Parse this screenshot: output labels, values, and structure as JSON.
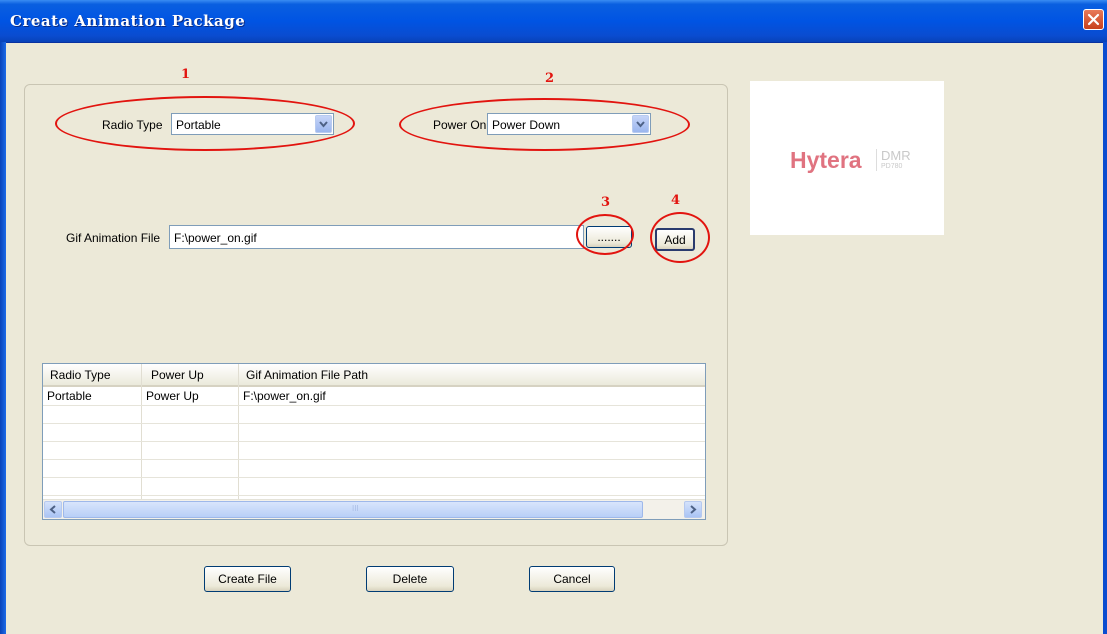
{
  "window": {
    "title": "Create Animation Package",
    "close_icon": "close-icon"
  },
  "form": {
    "radio_type_label": "Radio Type",
    "radio_type_value": "Portable",
    "power_on_label": "Power On",
    "power_on_value": "Power Down",
    "gif_label": "Gif Animation File",
    "gif_value": "F:\\power_on.gif",
    "browse_label": ".......",
    "add_label": "Add"
  },
  "annotations": [
    "1",
    "2",
    "3",
    "4"
  ],
  "table": {
    "columns": [
      "Radio Type",
      "Power Up",
      "Gif Animation  File Path"
    ],
    "rows": [
      [
        "Portable",
        "Power Up",
        "F:\\power_on.gif"
      ]
    ],
    "scroll_grip": "III"
  },
  "buttons": {
    "create": "Create File",
    "delete": "Delete",
    "cancel": "Cancel"
  },
  "logo": {
    "brand": "Hytera",
    "sub": "DMR",
    "model": "PD780",
    "brand_color": "#e07380"
  },
  "colors": {
    "annotation": "#e2140f",
    "titlebar": "#0054e3"
  }
}
